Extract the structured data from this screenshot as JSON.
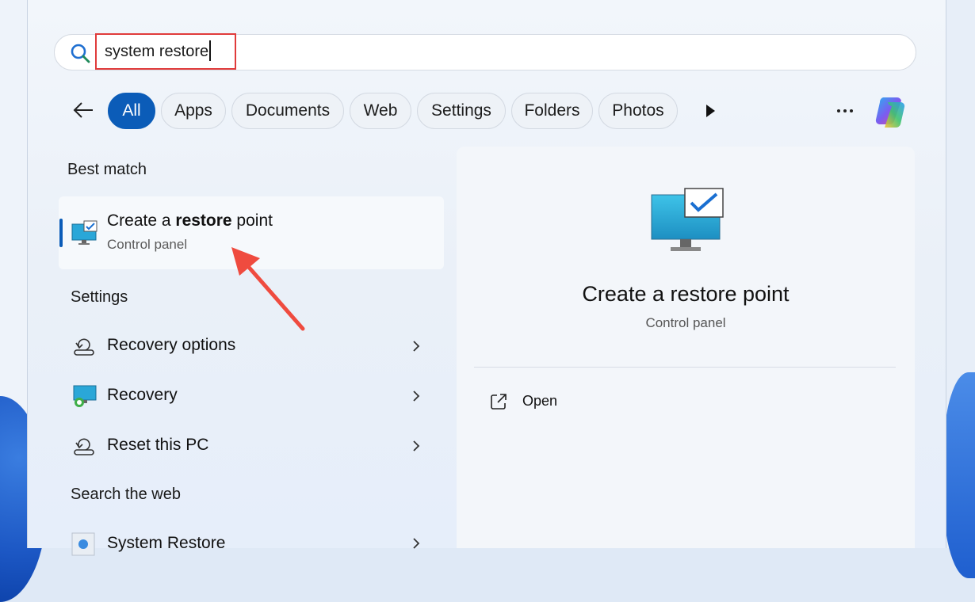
{
  "search": {
    "value": "system restore",
    "icon": "search-icon"
  },
  "filters": {
    "back_icon": "arrow-left-icon",
    "pills": [
      "All",
      "Apps",
      "Documents",
      "Web",
      "Settings",
      "Folders",
      "Photos"
    ],
    "active": "All",
    "more_icon": "play-icon",
    "overflow_icon": "ellipsis-icon",
    "copilot_icon": "copilot-icon"
  },
  "sections": {
    "best_match": "Best match",
    "settings": "Settings",
    "search_web": "Search the web"
  },
  "best_match": {
    "title_pre": "Create a ",
    "title_bold": "restore",
    "title_post": " point",
    "subtitle": "Control panel",
    "icon": "monitor-check-icon"
  },
  "settings_results": [
    {
      "label": "Recovery options",
      "icon": "recovery-options-icon"
    },
    {
      "label": "Recovery",
      "icon": "recovery-icon"
    },
    {
      "label": "Reset this PC",
      "icon": "reset-pc-icon"
    }
  ],
  "web_results": [
    {
      "label": "System Restore",
      "icon": "web-search-icon"
    }
  ],
  "preview": {
    "title": "Create a restore point",
    "subtitle": "Control panel",
    "action_open": "Open",
    "open_icon": "open-external-icon"
  },
  "colors": {
    "accent": "#0b5cb8",
    "highlight_border": "#e03b3b",
    "annotation_arrow": "#ef4b3f"
  }
}
